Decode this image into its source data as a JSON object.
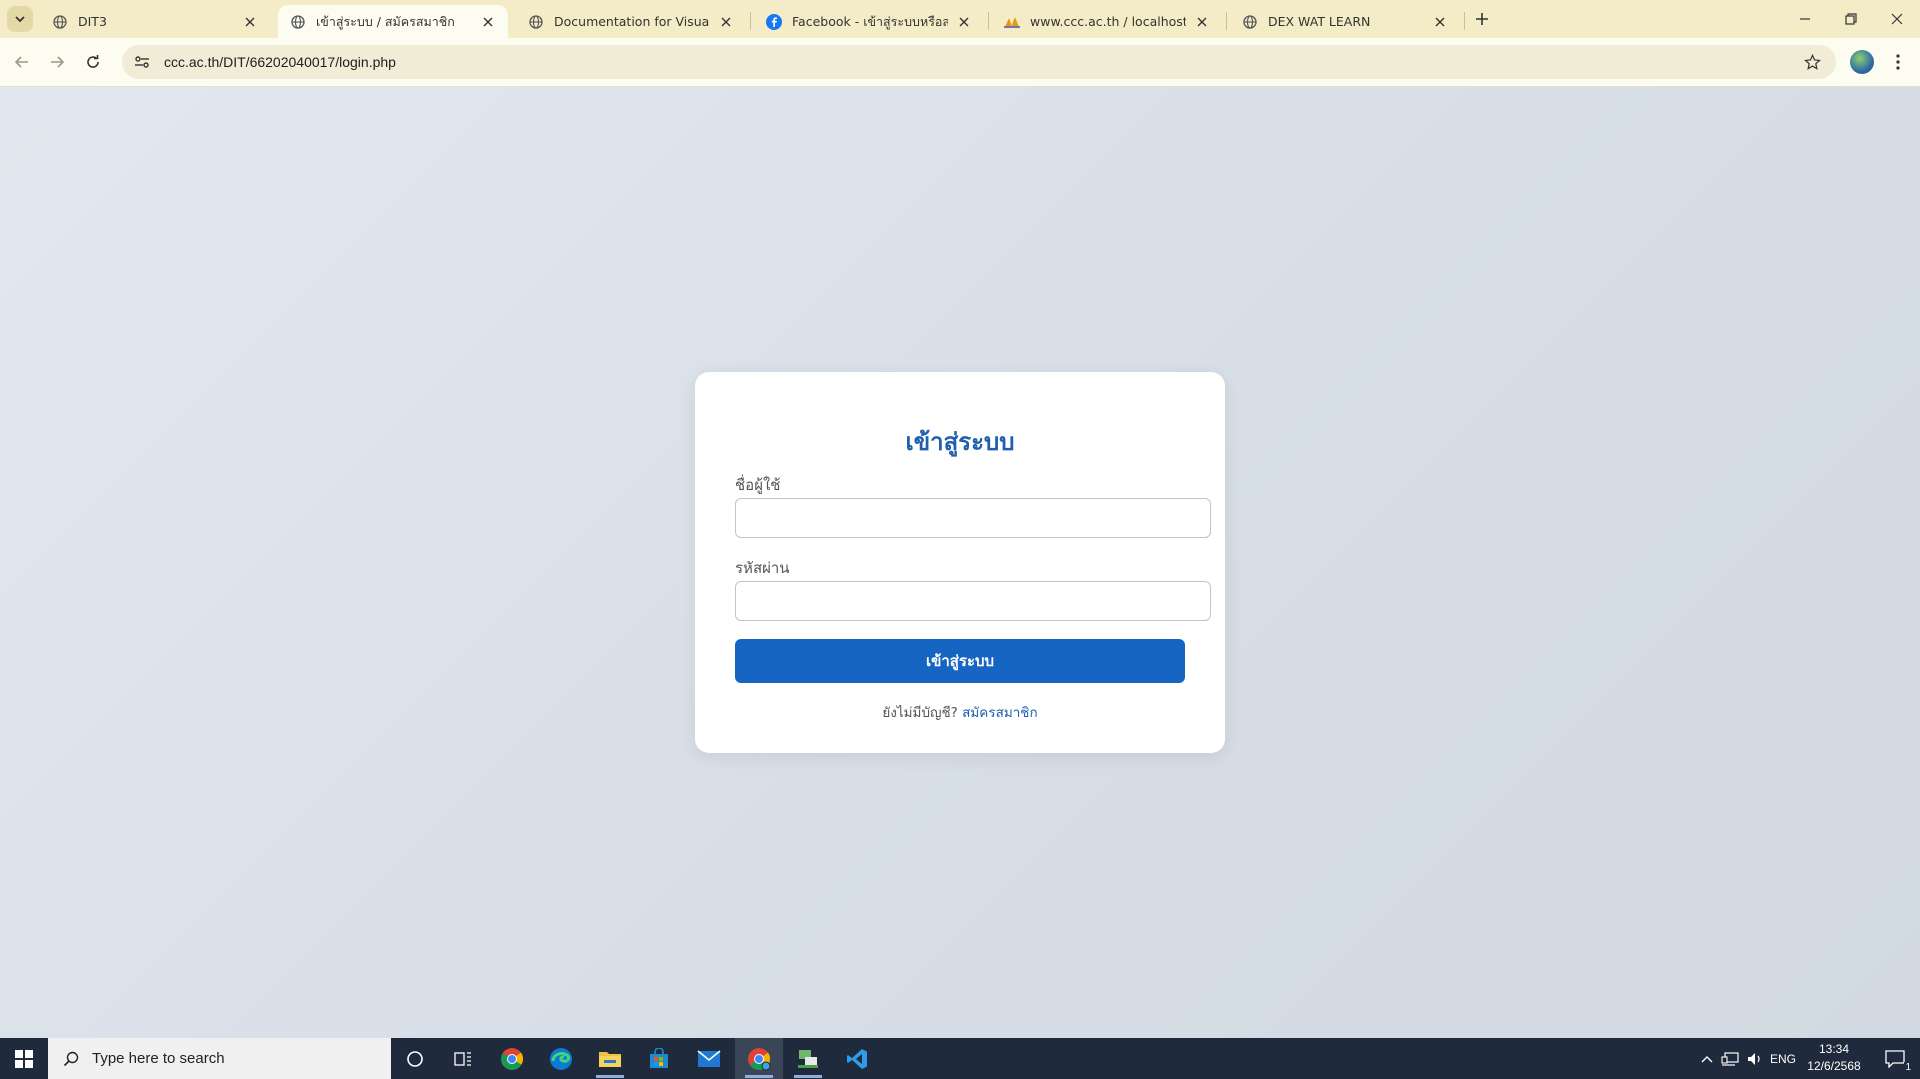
{
  "browser": {
    "tabs": [
      {
        "title": "DIT3",
        "icon": "globe-icon"
      },
      {
        "title": "เข้าสู่ระบบ / สมัครสมาชิก",
        "icon": "globe-icon",
        "active": true
      },
      {
        "title": "Documentation for Visual Studio",
        "icon": "globe-icon"
      },
      {
        "title": "Facebook - เข้าสู่ระบบหรือสมัครใช้งาน",
        "icon": "facebook-icon"
      },
      {
        "title": "www.ccc.ac.th / localhost / ccca",
        "icon": "phpmyadmin-icon"
      },
      {
        "title": "DEX WAT LEARN",
        "icon": "globe-icon"
      }
    ],
    "url": "ccc.ac.th/DIT/66202040017/login.php"
  },
  "login": {
    "heading": "เข้าสู่ระบบ",
    "username_label": "ชื่อผู้ใช้",
    "username_value": "",
    "password_label": "รหัสผ่าน",
    "password_value": "",
    "submit_label": "เข้าสู่ระบบ",
    "no_account_text": "ยังไม่มีบัญชี?",
    "signup_link": "สมัครสมาชิก",
    "accent_color": "#1765c2"
  },
  "taskbar": {
    "search_placeholder": "Type here to search",
    "apps": [
      "cortana-icon",
      "task-view-icon",
      "chrome-icon",
      "edge-icon",
      "file-explorer-icon",
      "store-icon",
      "mail-icon",
      "chrome-profile-icon",
      "network-app-icon",
      "vscode-icon"
    ],
    "language": "ENG",
    "time": "13:34",
    "date": "12/6/2568",
    "notification_count": "1"
  }
}
